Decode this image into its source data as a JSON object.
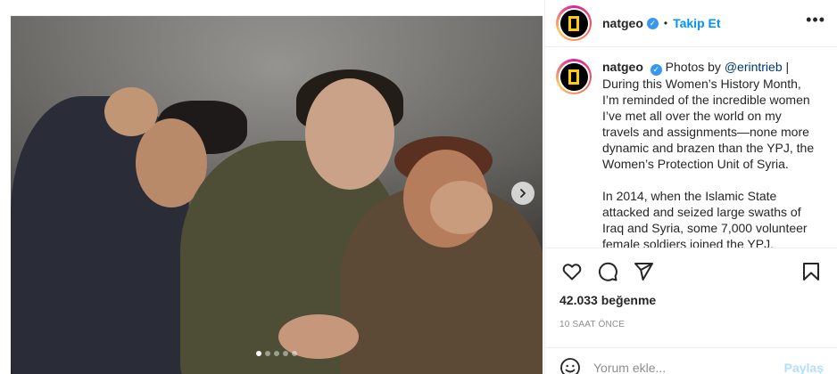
{
  "header": {
    "username": "natgeo",
    "separator": "•",
    "follow_label": "Takip Et",
    "more_icon": "more-dots-icon"
  },
  "caption": {
    "username": "natgeo",
    "prefix": "Photos by ",
    "mention": "@erintrieb",
    "after_mention": " | During this Women’s History Month, I’m reminded of the incredible women I’ve met all over the world on my travels and assignments—none more dynamic and brazen than the YPJ, the Women’s Protection Unit of Syria.",
    "paragraph2": "In 2014, when the Islamic State attacked and seized large swaths of Iraq and Syria, some 7,000 volunteer female soldiers joined the YPJ."
  },
  "actions": {
    "likes": "42.033 beğenme",
    "time": "10 SAAT ÖNCE"
  },
  "comment": {
    "placeholder": "Yorum ekle...",
    "share_label": "Paylaş"
  },
  "carousel": {
    "slide_count": 5,
    "active_index": 0
  },
  "colors": {
    "follow": "#0095f6",
    "verified": "#3897f0",
    "share_disabled": "#b2dffc",
    "natgeo_yellow": "#ffce00"
  }
}
